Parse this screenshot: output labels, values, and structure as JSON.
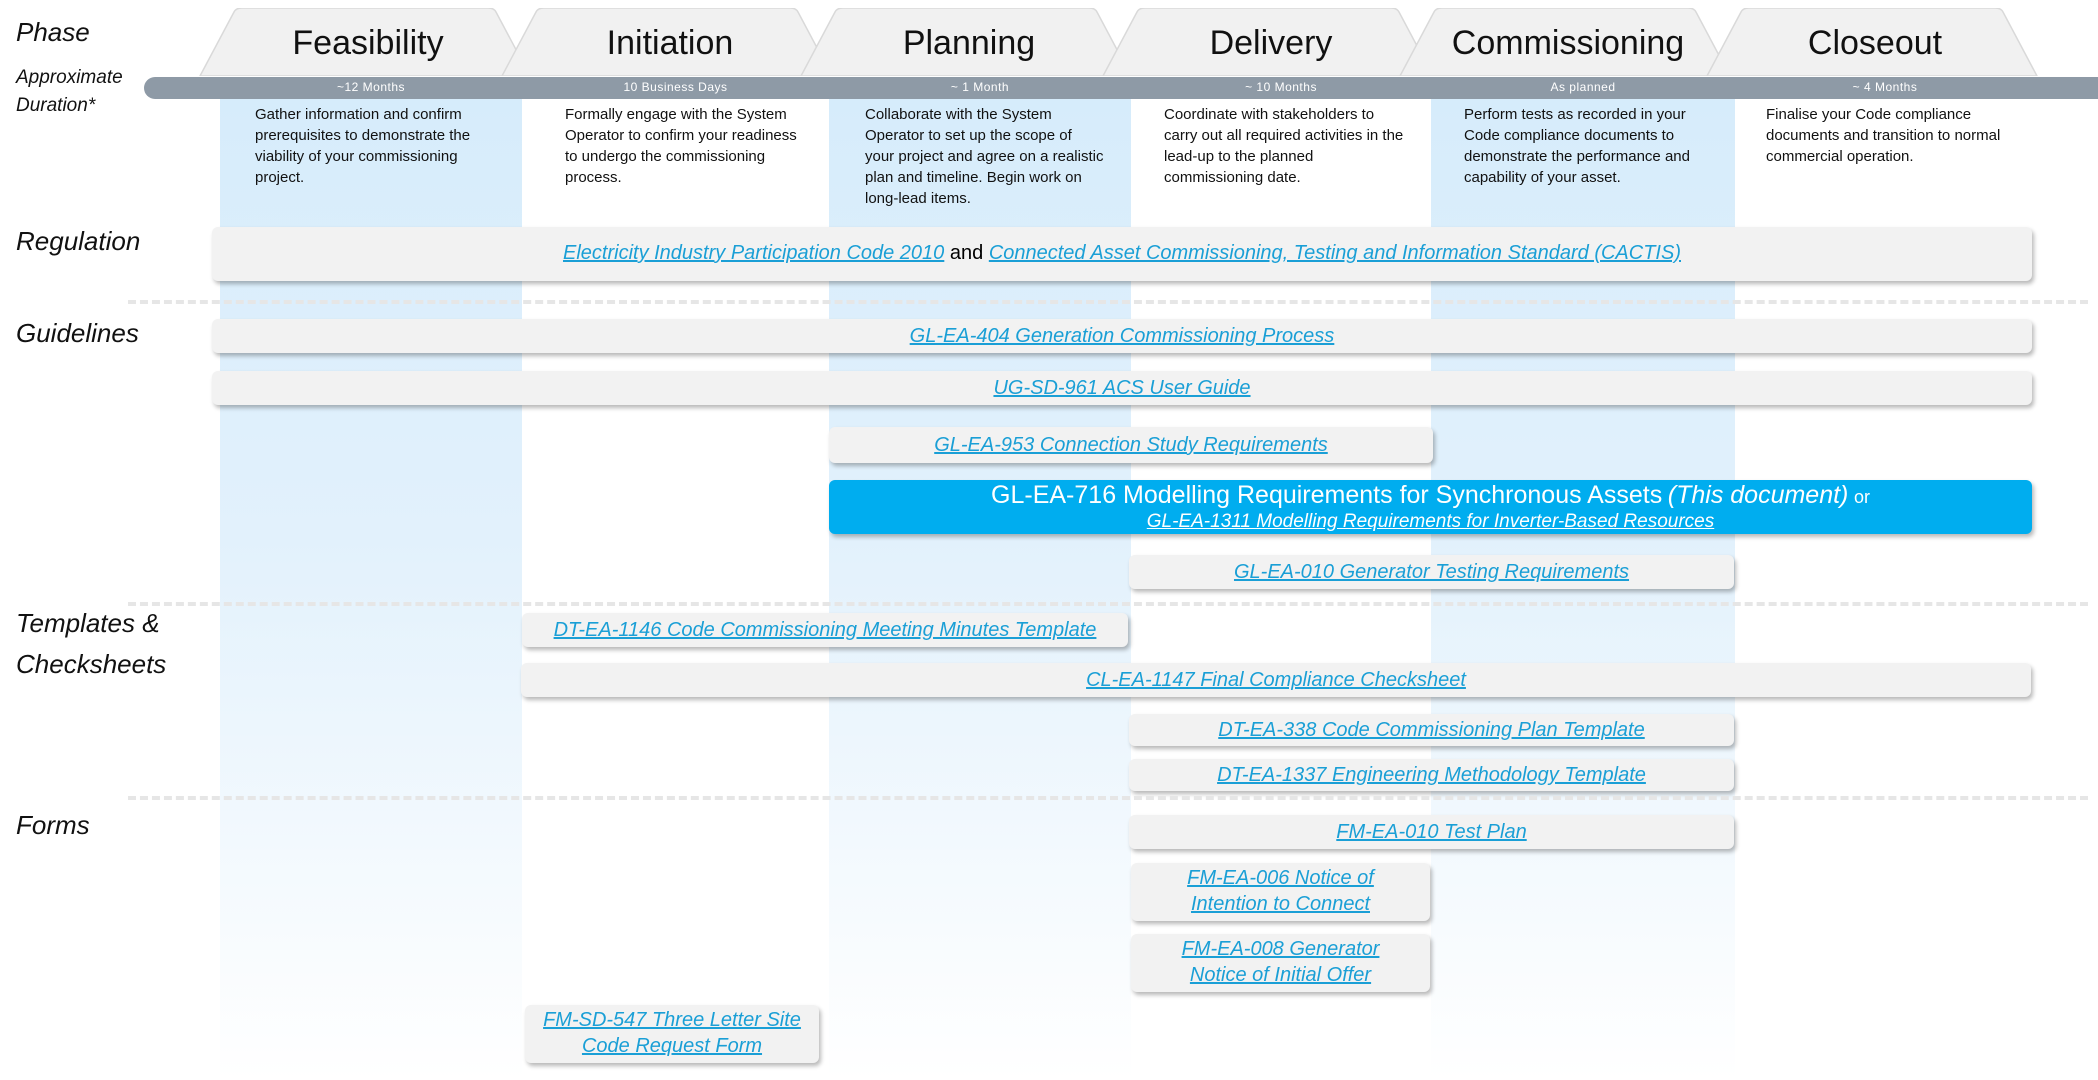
{
  "row_labels": {
    "phase": "Phase",
    "duration": "Approximate Duration*",
    "regulation": "Regulation",
    "guidelines": "Guidelines",
    "templates_1": "Templates &",
    "templates_2": "Checksheets",
    "forms": "Forms"
  },
  "phases": [
    {
      "name": "Feasibility",
      "duration": "~12 Months",
      "description": "Gather information and confirm prerequisites to demonstrate the viability of your commissioning project."
    },
    {
      "name": "Initiation",
      "duration": "10 Business Days",
      "description": "Formally engage with the System Operator to confirm your readiness to undergo the commissioning process."
    },
    {
      "name": "Planning",
      "duration": "~ 1 Month",
      "description": "Collaborate with the System Operator to set up the scope of your project and agree on a realistic plan and timeline. Begin work on long-lead items."
    },
    {
      "name": "Delivery",
      "duration": "~ 10 Months",
      "description": "Coordinate with stakeholders to carry out all required activities in the lead-up to the planned commissioning date."
    },
    {
      "name": "Commissioning",
      "duration": "As planned",
      "description": "Perform tests as recorded in your Code compliance documents to demonstrate the performance and capability of your asset."
    },
    {
      "name": "Closeout",
      "duration": "~ 4 Months",
      "description": "Finalise your Code compliance documents and transition to normal commercial operation."
    }
  ],
  "regulation": {
    "link1": "Electricity Industry Participation Code 2010",
    "conjunction": "and",
    "link2": "Connected Asset Commissioning, Testing and Information Standard (CACTIS)"
  },
  "guidelines": {
    "gl404": "GL-EA-404 Generation Commissioning Process",
    "ug961": "UG-SD-961 ACS User Guide",
    "gl953": "GL-EA-953 Connection Study Requirements",
    "gl716": "GL-EA-716 Modelling Requirements for Synchronous Assets",
    "gl716_note": "(This document)",
    "gl716_or": "or",
    "gl1311": "GL-EA-1311 Modelling Requirements for Inverter-Based Resources",
    "gl010": "GL-EA-010 Generator Testing Requirements"
  },
  "templates": {
    "dt1146": "DT-EA-1146 Code Commissioning Meeting Minutes Template",
    "cl1147": "CL-EA-1147 Final Compliance Checksheet",
    "dt338": "DT-EA-338 Code Commissioning Plan Template",
    "dt1337": "DT-EA-1337 Engineering Methodology Template"
  },
  "forms": {
    "fm010": "FM-EA-010 Test Plan",
    "fm006_l1": "FM-EA-006 Notice of",
    "fm006_l2": "Intention to Connect",
    "fm008_l1": "FM-EA-008 Generator",
    "fm008_l2": "Notice of Initial Offer",
    "fm547_l1": "FM-SD-547 Three Letter Site",
    "fm547_l2": "Code Request Form"
  },
  "colors": {
    "link": "#1a9fd6",
    "highlight": "#00adef",
    "column_tint": "#d6ecfb",
    "duration_bar": "#8e9aa6",
    "tab_fill": "#f1f1f1"
  }
}
